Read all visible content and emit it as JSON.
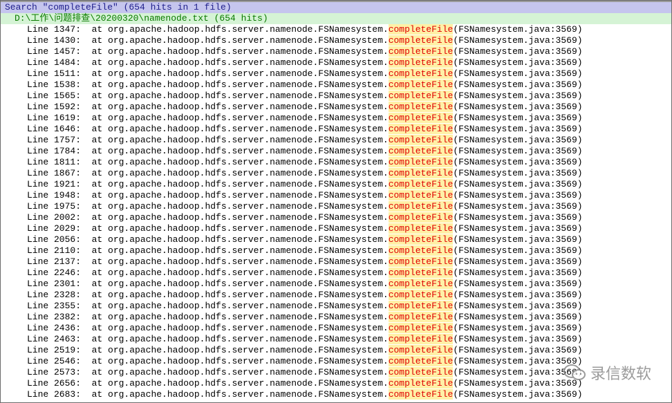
{
  "search_header": "Search \"completeFile\" (654 hits in 1 file)",
  "file_header": "D:\\工作\\问题排查\\20200320\\namenode.txt (654 hits)",
  "hit_prefix": "at org.apache.hadoop.hdfs.server.namenode.FSNamesystem.",
  "match_term": "completeFile",
  "hit_suffix": "(FSNamesystem.java:3569)",
  "lines": [
    "Line 1347:",
    "Line 1430:",
    "Line 1457:",
    "Line 1484:",
    "Line 1511:",
    "Line 1538:",
    "Line 1565:",
    "Line 1592:",
    "Line 1619:",
    "Line 1646:",
    "Line 1757:",
    "Line 1784:",
    "Line 1811:",
    "Line 1867:",
    "Line 1921:",
    "Line 1948:",
    "Line 1975:",
    "Line 2002:",
    "Line 2029:",
    "Line 2056:",
    "Line 2110:",
    "Line 2137:",
    "Line 2246:",
    "Line 2301:",
    "Line 2328:",
    "Line 2355:",
    "Line 2382:",
    "Line 2436:",
    "Line 2463:",
    "Line 2519:",
    "Line 2546:",
    "Line 2573:",
    "Line 2656:",
    "Line 2683:"
  ],
  "watermark": {
    "text": "录信数软",
    "icon": "wechat-bubble-icon"
  }
}
